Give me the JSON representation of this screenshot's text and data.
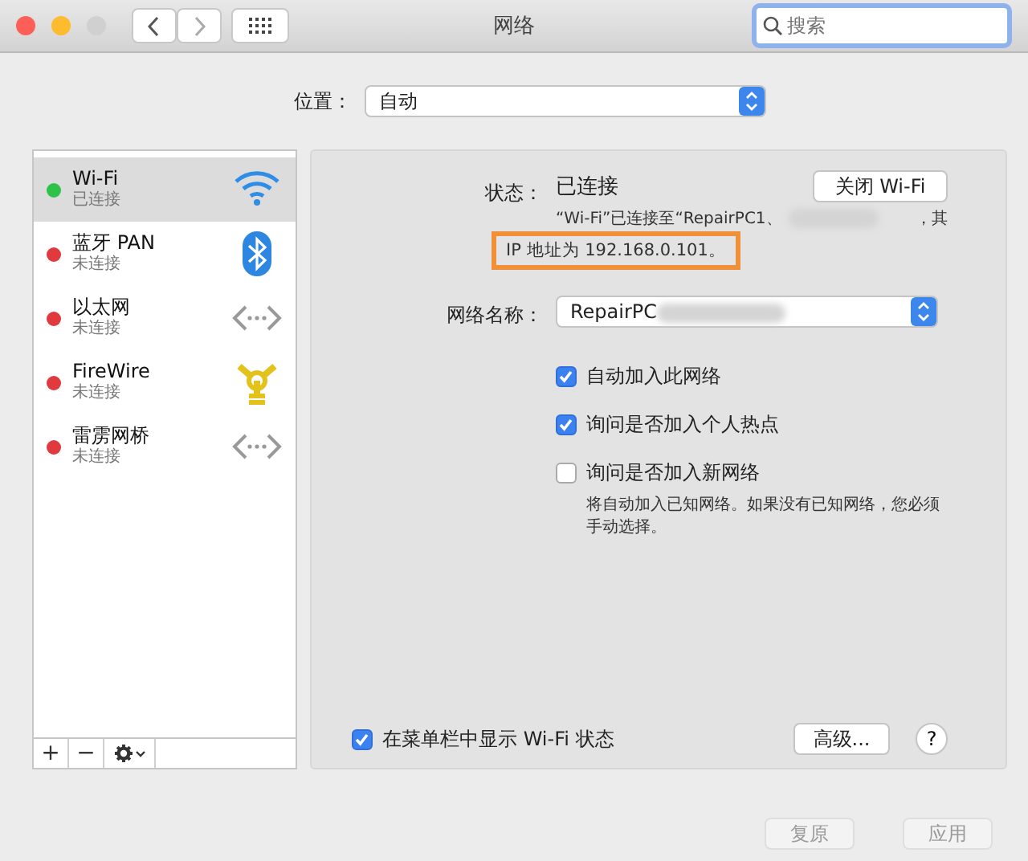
{
  "window": {
    "title": "网络",
    "search": {
      "placeholder": "搜索"
    }
  },
  "location": {
    "label": "位置：",
    "value": "自动"
  },
  "services": [
    {
      "name": "Wi-Fi",
      "status": "已连接",
      "color": "#2fc24b",
      "selected": true,
      "kind": "wifi"
    },
    {
      "name": "蓝牙 PAN",
      "status": "未连接",
      "color": "#e0393e",
      "selected": false,
      "kind": "bluetooth"
    },
    {
      "name": "以太网",
      "status": "未连接",
      "color": "#e0393e",
      "selected": false,
      "kind": "ethernet"
    },
    {
      "name": "FireWire",
      "status": "未连接",
      "color": "#e0393e",
      "selected": false,
      "kind": "firewire"
    },
    {
      "name": "雷雳网桥",
      "status": "未连接",
      "color": "#e0393e",
      "selected": false,
      "kind": "ethernet"
    }
  ],
  "service_toolbar": {
    "add": "+",
    "remove": "−"
  },
  "detail": {
    "status_label": "状态：",
    "status_value": "已连接",
    "toggle_button": "关闭 Wi-Fi",
    "status_line_1": "“Wi-Fi”已连接至“RepairPC1、",
    "status_line_1_end": "，其",
    "status_line_2": "IP 地址为 192.168.0.101。",
    "network_label": "网络名称：",
    "network_value": "RepairPC",
    "options": [
      {
        "label": "自动加入此网络",
        "checked": true
      },
      {
        "label": "询问是否加入个人热点",
        "checked": true
      },
      {
        "label": "询问是否加入新网络",
        "checked": false,
        "note": "将自动加入已知网络。如果没有已知网络，您必须手动选择。"
      }
    ],
    "menu_bar": {
      "label": "在菜单栏中显示 Wi-Fi 状态",
      "checked": true
    },
    "advanced_button": "高级...",
    "help_button": "?"
  },
  "footer": [
    {
      "label": "复原",
      "disabled": true
    },
    {
      "label": "应用",
      "disabled": true
    }
  ]
}
